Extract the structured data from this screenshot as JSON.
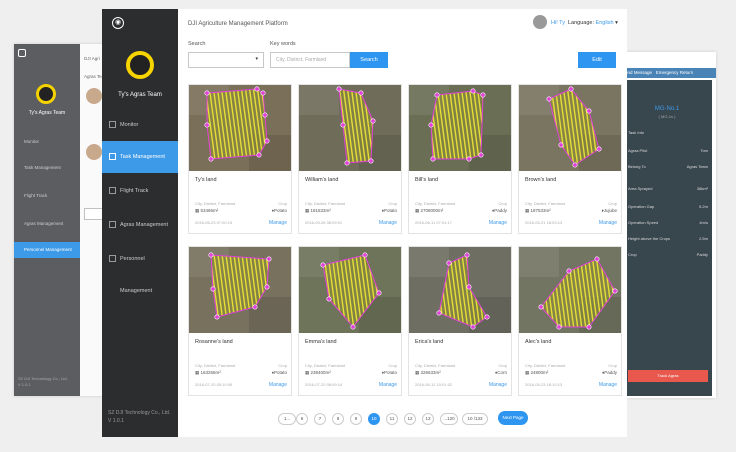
{
  "app": {
    "title": "DJI Agriculture Management Platform",
    "user_name": "Hi! Ty",
    "language_label": "Language:",
    "language_value": "English",
    "team_name": "Ty's Agras Team",
    "copyright_line1": "SZ DJI Technology Co., Ltd.",
    "version": "V 1.0.1"
  },
  "sidebar": {
    "items": [
      {
        "label": "Monitor",
        "icon": "monitor-icon",
        "active": false
      },
      {
        "label": "Task Management",
        "icon": "clipboard-icon",
        "active": true
      },
      {
        "label": "Flight Track",
        "icon": "flight-track-icon",
        "active": false
      },
      {
        "label": "Agras Management",
        "icon": "drone-icon",
        "active": false
      },
      {
        "label": "Personnel Management",
        "icon": "person-icon",
        "active": false
      }
    ]
  },
  "search": {
    "search_label": "Search",
    "keywords_label": "Key words",
    "keywords_placeholder": "City, District, Farmland",
    "search_button": "Search",
    "edit_button": "Edit"
  },
  "cards": [
    {
      "name": "Ty's land",
      "location": "City, District, Farmland",
      "crop_label": "Crop",
      "area": "53466m²",
      "crop": "Potato",
      "date": "2016-06-23 07:00:13",
      "manage": "Manage"
    },
    {
      "name": "William's land",
      "location": "City, District, Farmland",
      "crop_label": "Crop",
      "area": "181533m²",
      "crop": "Potato",
      "date": "2016-09-26 08:09:01",
      "manage": "Manage"
    },
    {
      "name": "Bill's land",
      "location": "City, District, Farmland",
      "crop_label": "Crop",
      "area": "2708000m²",
      "crop": "Paddy",
      "date": "2016-06-11 07:01:17",
      "manage": "Manage"
    },
    {
      "name": "Brown's land",
      "location": "City, District, Farmland",
      "crop_label": "Crop",
      "area": "187533m²",
      "crop": "Jujube",
      "date": "2016-05-21 18:03:13",
      "manage": "Manage"
    },
    {
      "name": "Rosanne's land",
      "location": "City, District, Farmland",
      "crop_label": "Crop",
      "area": "163266m²",
      "crop": "Potato",
      "date": "2016-07-20 05:10:09",
      "manage": "Manage"
    },
    {
      "name": "Emma's land",
      "location": "City, District, Farmland",
      "crop_label": "Crop",
      "area": "238400m²",
      "crop": "Potato",
      "date": "2016-07-20 08:09:14",
      "manage": "Manage"
    },
    {
      "name": "Erica's land",
      "location": "City, District, Farmland",
      "crop_label": "Crop",
      "area": "326633m²",
      "crop": "Corn",
      "date": "2016-06-12 10:01:02",
      "manage": "Manage"
    },
    {
      "name": "Alec's land",
      "location": "City, District, Farmland",
      "crop_label": "Crop",
      "area": "24800m²",
      "crop": "Paddy",
      "date": "2016-05-23 18:10:13",
      "manage": "Manage"
    }
  ],
  "pagination": {
    "pages": [
      "1...",
      "6",
      "7",
      "8",
      "9",
      "10",
      "11",
      "12",
      "13",
      "...120"
    ],
    "active": "10",
    "goto": "10 /133",
    "next": "Next Page"
  },
  "back_right": {
    "send_message": "Send Message",
    "emergency_return": "Emergency Return",
    "panel_title": "MG-No.1",
    "panel_sub": "( MG-1s )",
    "task_info": "Task Info",
    "rows": [
      {
        "k": "Agras Pilot",
        "v": "Tom"
      },
      {
        "k": "Belong To",
        "v": "Agras Team"
      },
      {
        "k": "Area Sprayed",
        "v": "38km²"
      },
      {
        "k": "Operation Gap",
        "v": "5.2m"
      },
      {
        "k": "Operation Speed",
        "v": "4m/s"
      },
      {
        "k": "Height above the Crops",
        "v": "2.5m"
      },
      {
        "k": "Crop",
        "v": "Paddy"
      }
    ],
    "button": "Track Agras"
  },
  "back_left": {
    "title": "DJI Agri",
    "label": "Agras Team",
    "team": "Ty's Agras Team",
    "nav": [
      "Monitor",
      "Task Management",
      "Flight Track",
      "Agras Management",
      "Personnel Management"
    ],
    "copyright": "SZ DJI Technology Co., Ltd.",
    "version": "V 1.0.1"
  },
  "colors": {
    "accent": "#2e95f0",
    "sidebar": "#2c2d2f",
    "boundary": "#e040d8",
    "stripe": "#e6dd38"
  }
}
